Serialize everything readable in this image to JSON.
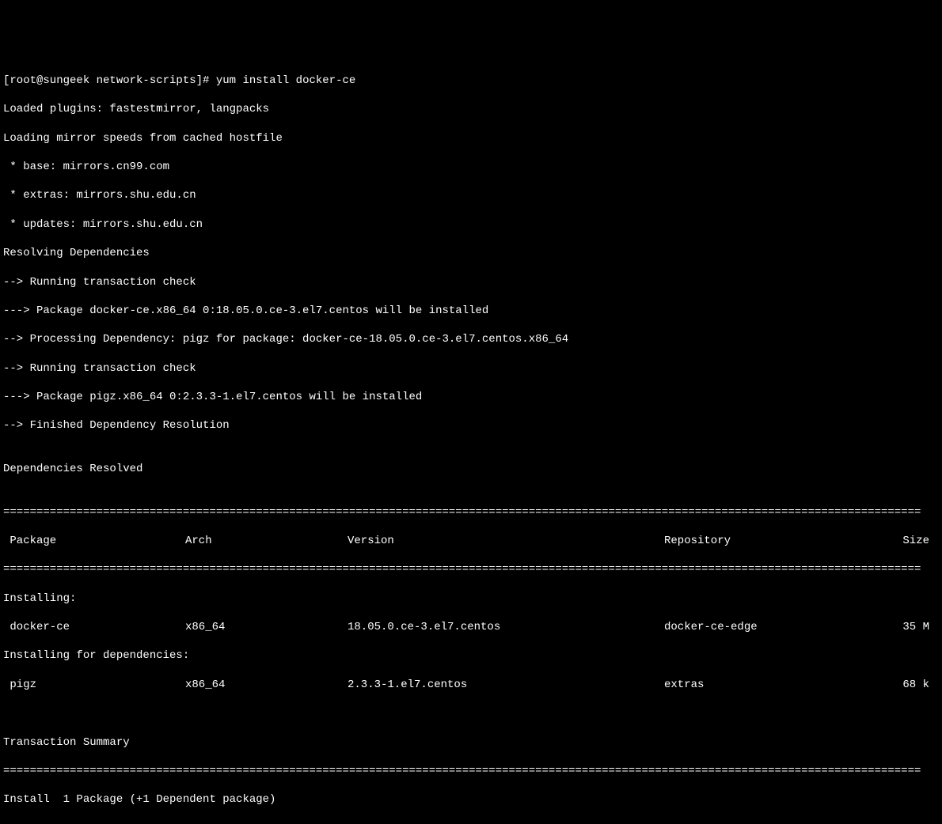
{
  "prompt": {
    "user_host": "[root@sungeek network-scripts]#",
    "command": "yum install docker-ce"
  },
  "output_lines": [
    "Loaded plugins: fastestmirror, langpacks",
    "Loading mirror speeds from cached hostfile",
    " * base: mirrors.cn99.com",
    " * extras: mirrors.shu.edu.cn",
    " * updates: mirrors.shu.edu.cn",
    "Resolving Dependencies",
    "--> Running transaction check",
    "---> Package docker-ce.x86_64 0:18.05.0.ce-3.el7.centos will be installed",
    "--> Processing Dependency: pigz for package: docker-ce-18.05.0.ce-3.el7.centos.x86_64",
    "--> Running transaction check",
    "---> Package pigz.x86_64 0:2.3.3-1.el7.centos will be installed",
    "--> Finished Dependency Resolution",
    "",
    "Dependencies Resolved",
    ""
  ],
  "table": {
    "headers": {
      "package": " Package",
      "arch": "Arch",
      "version": "Version",
      "repository": "Repository",
      "size": "Size"
    },
    "section_installing": "Installing:",
    "section_deps": "Installing for dependencies:",
    "rows": {
      "installing": [
        {
          "package": " docker-ce",
          "arch": "x86_64",
          "version": "18.05.0.ce-3.el7.centos",
          "repository": "docker-ce-edge",
          "size": "35 M"
        }
      ],
      "deps": [
        {
          "package": " pigz",
          "arch": "x86_64",
          "version": "2.3.3-1.el7.centos",
          "repository": "extras",
          "size": "68 k"
        }
      ]
    }
  },
  "summary": {
    "title": "Transaction Summary",
    "line": "Install  1 Package (+1 Dependent package)"
  },
  "divider": "=========================================================================================================================================="
}
